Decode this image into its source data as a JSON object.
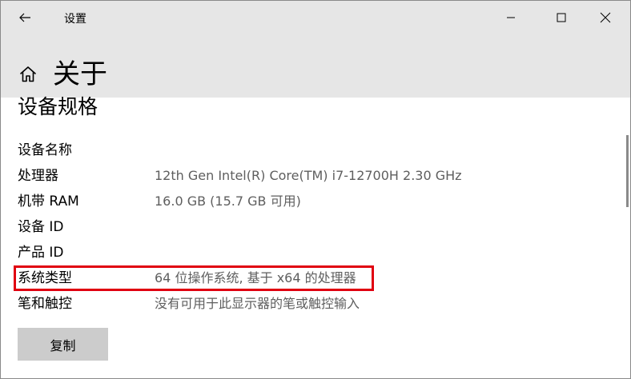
{
  "window": {
    "title": "设置"
  },
  "page": {
    "title": "关于"
  },
  "section": {
    "heading": "设备规格"
  },
  "specs": [
    {
      "label": "设备名称",
      "value": ""
    },
    {
      "label": "处理器",
      "value": "12th Gen Intel(R) Core(TM) i7-12700H   2.30 GHz"
    },
    {
      "label": "机带 RAM",
      "value": "16.0 GB (15.7 GB 可用)"
    },
    {
      "label": "设备 ID",
      "value": ""
    },
    {
      "label": "产品 ID",
      "value": ""
    },
    {
      "label": "系统类型",
      "value": "64 位操作系统, 基于 x64 的处理器"
    },
    {
      "label": "笔和触控",
      "value": "没有可用于此显示器的笔或触控输入"
    }
  ],
  "buttons": {
    "copy": "复制"
  },
  "icons": {
    "back": "back-arrow-icon",
    "home": "home-icon",
    "minimize": "minimize-icon",
    "maximize": "maximize-icon",
    "close": "close-icon"
  },
  "colors": {
    "highlight": "#e00010",
    "titlebar": "#e6e6e6",
    "button": "#cccccc"
  }
}
